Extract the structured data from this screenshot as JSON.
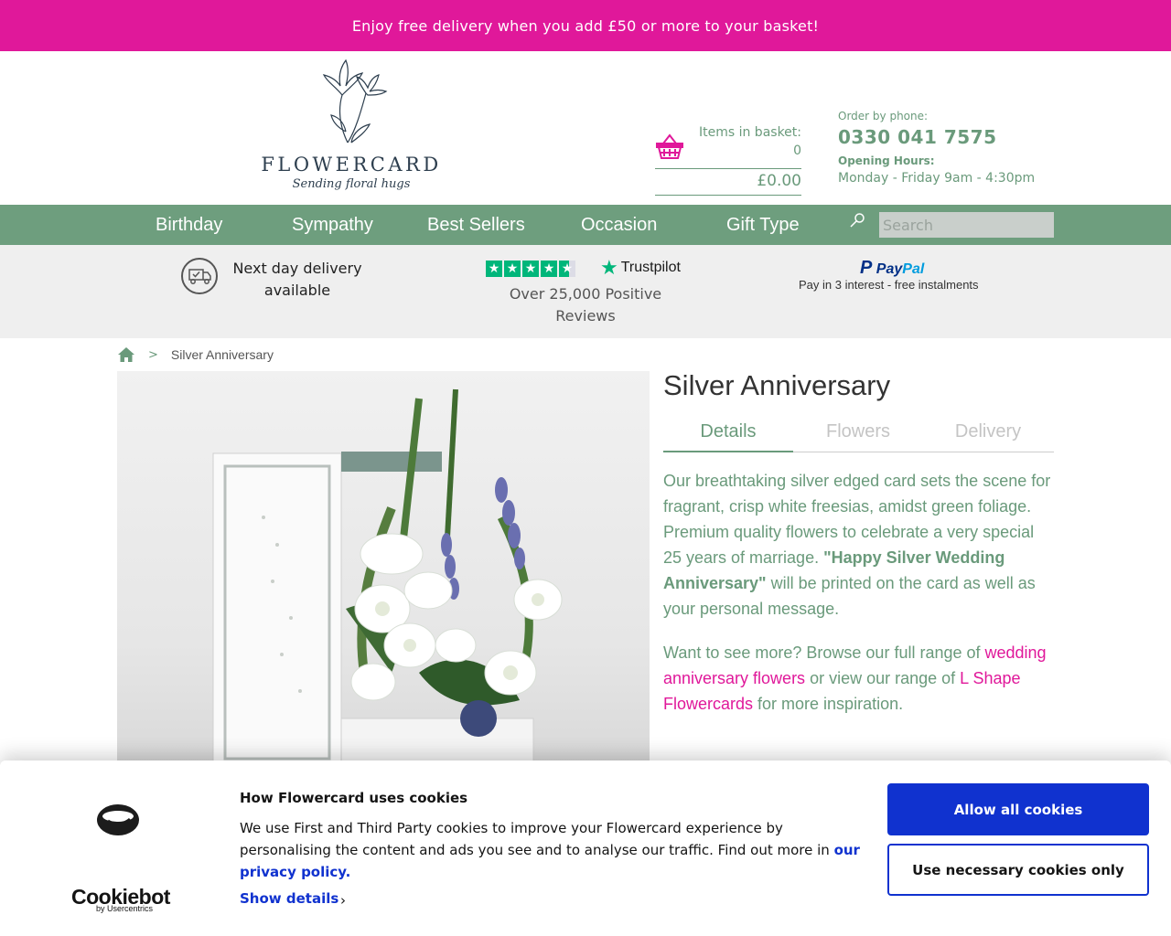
{
  "promo": {
    "text": "Enjoy free delivery when you add £50 or more to your basket!"
  },
  "logo": {
    "name": "FLOWERCARD",
    "tagline": "Sending floral hugs"
  },
  "basket": {
    "label": "Items in basket:",
    "count": "0",
    "total": "£0.00",
    "icon": "basket-icon"
  },
  "contact": {
    "order_label": "Order by phone:",
    "phone": "0330 041 7575",
    "hours_label": "Opening Hours:",
    "hours": "Monday - Friday 9am - 4:30pm"
  },
  "nav": {
    "items": [
      {
        "label": "Birthday"
      },
      {
        "label": "Sympathy"
      },
      {
        "label": "Best Sellers"
      },
      {
        "label": "Occasion"
      },
      {
        "label": "Gift Type"
      }
    ],
    "search_placeholder": "Search",
    "search_icon": "search-icon"
  },
  "trust": {
    "delivery": "Next day delivery available",
    "trustpilot_brand": "Trustpilot",
    "trustpilot_text": "Over 25,000 Positive Reviews",
    "trustpilot_rating": 4.5,
    "paypal_brand_1": "Pay",
    "paypal_brand_2": "Pal",
    "paypal_text": "Pay in 3 interest - free instalments"
  },
  "breadcrumb": {
    "separator": ">",
    "current": "Silver Anniversary"
  },
  "product": {
    "title": "Silver Anniversary",
    "tabs": [
      {
        "label": "Details",
        "active": true
      },
      {
        "label": "Flowers",
        "active": false
      },
      {
        "label": "Delivery",
        "active": false
      }
    ],
    "desc_1": "Our breathtaking silver edged card sets the scene for fragrant, crisp white freesias, amidst green foliage. Premium quality flowers to celebrate a very special 25 years of marriage. ",
    "desc_1_quote": "\"Happy Silver Wedding Anniversary\"",
    "desc_1_end": " will be printed on the card as well as your personal message.",
    "desc_2_a": "Want to see more? Browse our full range of ",
    "link_1": "wedding anniversary flowers",
    "desc_2_b": " or view our range of ",
    "link_2": "L Shape Flowercards",
    "desc_2_c": " for more inspiration."
  },
  "cookie": {
    "brand": "Cookiebot",
    "brand_sub": "by Usercentrics",
    "title": "How Flowercard uses cookies",
    "text": "We use First and Third Party cookies to improve your Flowercard experience by personalising the content and ads you see and to analyse our traffic. Find out more in ",
    "link": "our privacy policy.",
    "show_details": "Show details",
    "chevron": "›",
    "allow_all": "Allow all cookies",
    "necessary_only": "Use necessary cookies only"
  },
  "colors": {
    "promo_bg": "#e0189a",
    "brand_green": "#6e9e7e",
    "link_pink": "#e0189a",
    "cookie_blue": "#1032cf",
    "trustpilot_green": "#00b67a"
  }
}
